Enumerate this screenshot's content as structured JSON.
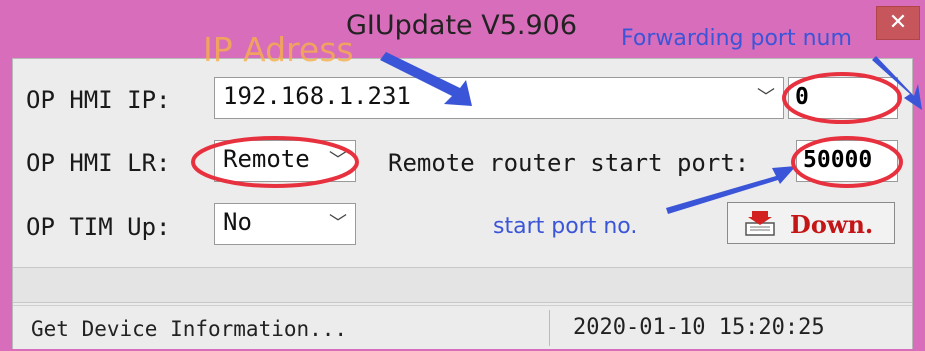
{
  "window": {
    "title": "GIUpdate V5.906",
    "close_glyph": "✕",
    "accent": "#d86dbb"
  },
  "form": {
    "ip_label": "OP HMI IP:",
    "ip_value": "192.168.1.231",
    "forward_port_value": "0",
    "lr_label": "OP HMI LR:",
    "lr_value": "Remote",
    "remote_router_label": "Remote router start port:",
    "remote_router_value": "50000",
    "tim_label": "OP TIM Up:",
    "tim_value": "No",
    "down_button_label": "Down."
  },
  "status": {
    "message": "Get Device Information...",
    "datetime": "2020-01-10  15:20:25"
  },
  "annotations": {
    "ip_adress": "IP Adress",
    "forwarding_port": "Forwarding port num",
    "start_port": "start port no.",
    "arrow_color": "#3b55d8",
    "circle_color": "#e8313f"
  },
  "icons": {
    "close": "close-icon",
    "dropdown": "chevron-down-icon",
    "download": "download-icon"
  }
}
